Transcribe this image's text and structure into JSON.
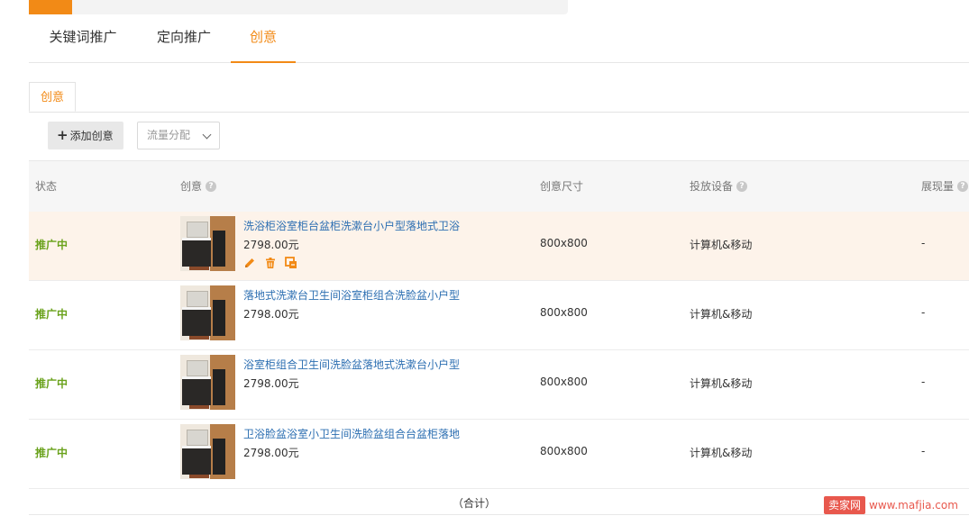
{
  "colors": {
    "accent": "#f28a16",
    "status_active": "#6aa21c",
    "link": "#2d6fb2"
  },
  "main_tabs": [
    {
      "label": "关键词推广",
      "active": false
    },
    {
      "label": "定向推广",
      "active": false
    },
    {
      "label": "创意",
      "active": true
    }
  ],
  "sub_tab": {
    "label": "创意"
  },
  "toolbar": {
    "add_label": "添加创意",
    "dropdown_value": "流量分配"
  },
  "table": {
    "headers": {
      "status": "状态",
      "creative": "创意",
      "size": "创意尺寸",
      "device": "投放设备",
      "impressions": "展现量"
    },
    "rows": [
      {
        "status": "推广中",
        "title": "洗浴柜浴室柜台盆柜洗漱台小户型落地式卫浴",
        "price": "2798.00元",
        "size": "800x800",
        "device": "计算机&移动",
        "impressions": "-",
        "icons": [
          "pencil-icon",
          "trash-icon",
          "replace-icon"
        ]
      },
      {
        "status": "推广中",
        "title": "落地式洗漱台卫生间浴室柜组合洗脸盆小户型",
        "price": "2798.00元",
        "size": "800x800",
        "device": "计算机&移动",
        "impressions": "-"
      },
      {
        "status": "推广中",
        "title": "浴室柜组合卫生间洗脸盆落地式洗漱台小户型",
        "price": "2798.00元",
        "size": "800x800",
        "device": "计算机&移动",
        "impressions": "-"
      },
      {
        "status": "推广中",
        "title": "卫浴脸盆浴室小卫生间洗脸盆组合台盆柜落地",
        "price": "2798.00元",
        "size": "800x800",
        "device": "计算机&移动",
        "impressions": "-"
      }
    ],
    "total_label": "（合计）"
  },
  "watermark": {
    "badge": "卖家网",
    "url": "www.mafjia.com"
  }
}
